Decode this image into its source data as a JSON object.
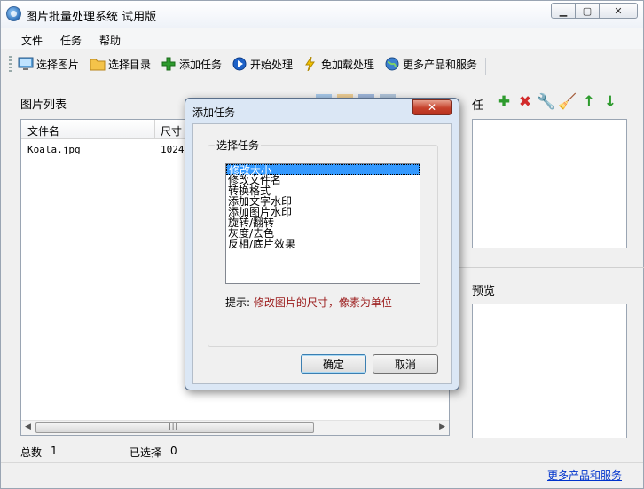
{
  "window": {
    "title": "图片批量处理系统 试用版",
    "min": "▁",
    "max": "▢",
    "close": "✕"
  },
  "menu": {
    "file": "文件",
    "task": "任务",
    "help": "帮助"
  },
  "toolbar": {
    "select_images": "选择图片",
    "select_folder": "选择目录",
    "add_task": "添加任务",
    "start": "开始处理",
    "no_load": "免加载处理",
    "more": "更多产品和服务"
  },
  "left": {
    "label": "图片列表",
    "columns": {
      "name": "文件名",
      "size": "尺寸"
    },
    "rows": [
      {
        "name": "Koala.jpg",
        "size": "1024"
      }
    ],
    "total_label": "总数",
    "total_value": "1",
    "selected_label": "已选择",
    "selected_value": "0"
  },
  "right": {
    "tasks_label": "任",
    "preview_label": "预览"
  },
  "footer": {
    "more_link": "更多产品和服务"
  },
  "dialog": {
    "title": "添加任务",
    "close": "✕",
    "group_title": "选择任务",
    "tasks": [
      "修改大小",
      "修改文件名",
      "转换格式",
      "添加文字水印",
      "添加图片水印",
      "旋转/翻转",
      "灰度/去色",
      "反相/底片效果"
    ],
    "selected_index": 0,
    "hint_prefix": "提示:",
    "hint_text": "修改图片的尺寸，像素为单位",
    "ok": "确定",
    "cancel": "取消"
  },
  "colors": {
    "accent": "#3399ff",
    "hint": "#9b1c1c",
    "link": "#0033cc"
  }
}
